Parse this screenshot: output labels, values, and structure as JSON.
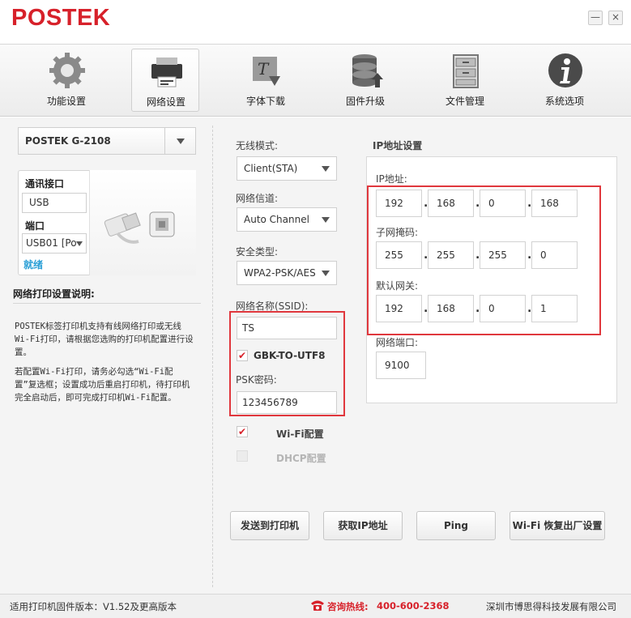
{
  "app": {
    "logo": "POSTEK"
  },
  "window": {
    "minimize": "—",
    "close": "×"
  },
  "toolbar": {
    "items": [
      {
        "label": "功能设置",
        "icon": "gear-icon"
      },
      {
        "label": "网络设置",
        "icon": "printer-network-icon"
      },
      {
        "label": "字体下载",
        "icon": "font-download-icon"
      },
      {
        "label": "固件升级",
        "icon": "firmware-database-icon"
      },
      {
        "label": "文件管理",
        "icon": "file-cabinet-icon"
      },
      {
        "label": "系统选项",
        "icon": "info-icon"
      }
    ]
  },
  "left": {
    "printer_model": "POSTEK G-2108",
    "comm_label": "通讯接口",
    "comm_value": "USB",
    "port_label": "端口",
    "port_value": "USB01 [Po",
    "ready": "就绪",
    "desc_title": "网络打印设置说明:",
    "desc_p1": "POSTEK标签打印机支持有线网络打印或无线Wi-Fi打印，请根据您选购的打印机配置进行设置。",
    "desc_p2": "若配置Wi-Fi打印，请务必勾选“Wi-Fi配置”复选框；设置成功后重启打印机，待打印机完全启动后，即可完成打印机Wi-Fi配置。"
  },
  "wireless": {
    "mode_label": "无线模式:",
    "mode_value": "Client(STA)",
    "channel_label": "网络信道:",
    "channel_value": "Auto Channel",
    "security_label": "安全类型:",
    "security_value": "WPA2-PSK/AES",
    "ssid_label": "网络名称(SSID):",
    "ssid_value": "TS",
    "gbk_label": "GBK-TO-UTF8",
    "gbk_checked": true,
    "psk_label": "PSK密码:",
    "psk_value": "123456789",
    "wifi_label": "Wi-Fi配置",
    "wifi_checked": true,
    "dhcp_label": "DHCP配置",
    "dhcp_checked": false
  },
  "ip": {
    "section_title": "IP地址设置",
    "ip_label": "IP地址:",
    "ip": [
      "192",
      "168",
      "0",
      "168"
    ],
    "mask_label": "子网掩码:",
    "mask": [
      "255",
      "255",
      "255",
      "0"
    ],
    "gateway_label": "默认网关:",
    "gateway": [
      "192",
      "168",
      "0",
      "1"
    ],
    "port_label": "网络端口:",
    "port_value": "9100"
  },
  "actions": {
    "send": "发送到打印机",
    "get_ip": "获取IP地址",
    "ping": "Ping",
    "wifi_reset": "Wi-Fi 恢复出厂设置"
  },
  "status": {
    "firmware": "适用打印机固件版本：V1.52及更高版本",
    "hotline_label": "咨询热线:",
    "hotline_number": "400-600-2368",
    "company": "深圳市博思得科技发展有限公司"
  },
  "colors": {
    "brand_red": "#d7212a",
    "highlight_red": "#e0373d",
    "link_blue": "#2a9fd6"
  }
}
